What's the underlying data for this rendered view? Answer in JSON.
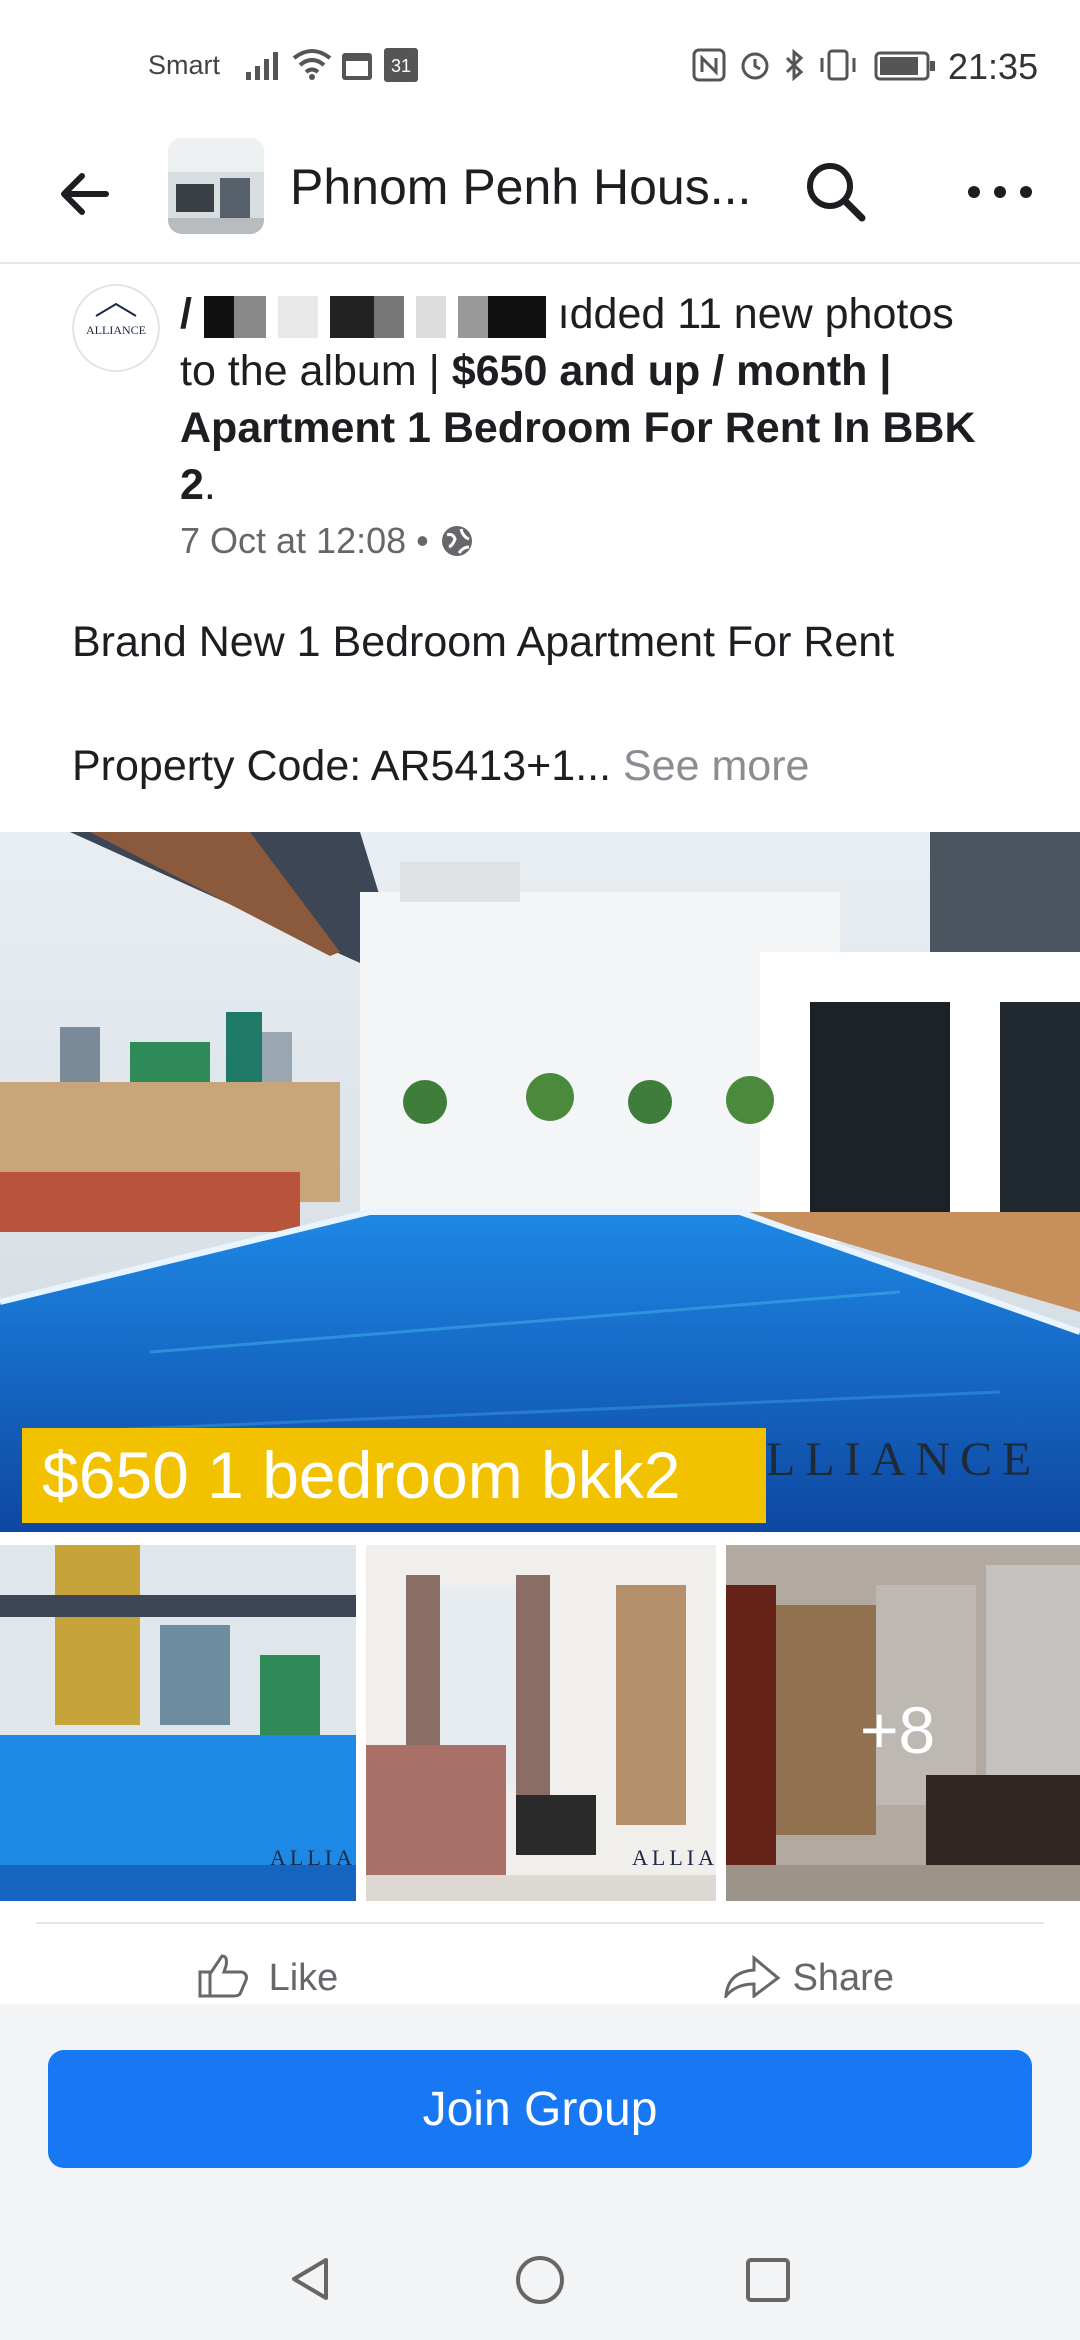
{
  "status_bar": {
    "carrier": "Smart",
    "calendar_day": "31",
    "time": "21:35"
  },
  "app_bar": {
    "group_name": "Phnom Penh Hous...",
    "back_icon": "back-arrow-icon",
    "search_icon": "search-icon",
    "more_icon": "more-dots-icon"
  },
  "post": {
    "avatar_text": "ALLIANCE",
    "header_plain": "ıdded 11 new photos to the album |",
    "header_bold": "$650 and up / month | Apartment 1 Bedroom For Rent In BBK 2",
    "header_period": ".",
    "timestamp": "7 Oct at 12:08",
    "separator": "•",
    "privacy_icon": "globe-icon",
    "body_line1": "Brand New 1 Bedroom Apartment For Rent",
    "body_line2": "Property Code: AR5413+1...",
    "see_more": "See more"
  },
  "photos": {
    "price_banner": "$650  1 bedroom bkk2",
    "watermark": "LLIANCE",
    "thumb_watermark": "ALLIA",
    "more_count": "+8"
  },
  "actions": {
    "like": "Like",
    "share": "Share"
  },
  "join_button": "Join Group",
  "colors": {
    "brand_blue": "#1877f2",
    "banner_yellow": "#f2c200",
    "pool_blue": "#1a73e8"
  }
}
